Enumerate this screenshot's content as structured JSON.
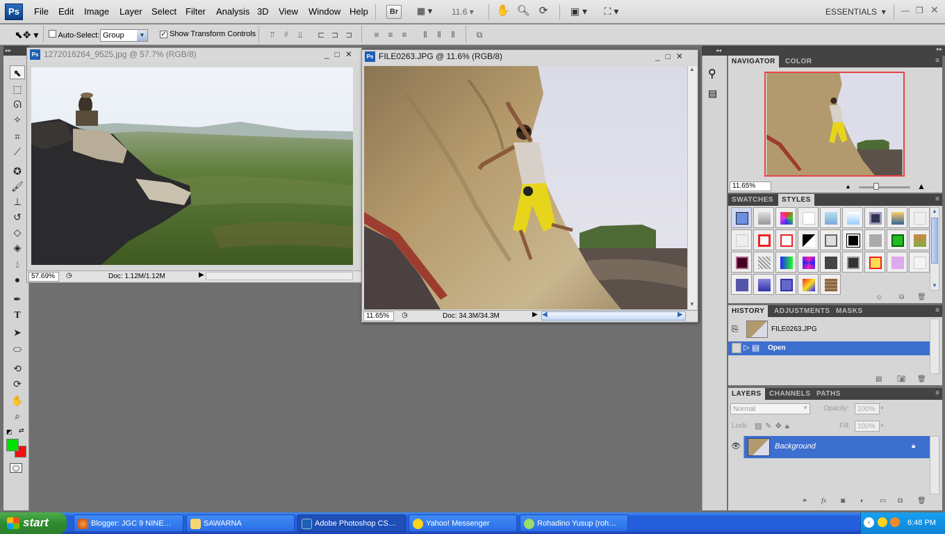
{
  "app": {
    "logo": "Ps"
  },
  "menu": [
    "File",
    "Edit",
    "Image",
    "Layer",
    "Select",
    "Filter",
    "Analysis",
    "3D",
    "View",
    "Window",
    "Help"
  ],
  "menubar": {
    "bridge_label": "Br",
    "zoom": "11.6",
    "workspace": "ESSENTIALS",
    "icons": [
      "bridge-icon",
      "screen-mode-icon",
      "hand-icon",
      "zoom-icon",
      "rotate-view-icon",
      "arrange-documents-icon",
      "screen-mode-menu-icon"
    ]
  },
  "options": {
    "auto_select_label": "Auto-Select:",
    "auto_select_checked": false,
    "group_value": "Group",
    "show_transform_label": "Show Transform Controls",
    "show_transform_checked": true
  },
  "documents": [
    {
      "title": "1272016264_9525.jpg @ 57.7% (RGB/8)",
      "zoom": "57.69%",
      "doc_size": "Doc: 1.12M/1.12M",
      "active": false
    },
    {
      "title": "FILE0263.JPG @ 11.6% (RGB/8)",
      "zoom": "11.65%",
      "doc_size": "Doc: 34.3M/34.3M",
      "active": true
    }
  ],
  "navigator": {
    "tabs": [
      "NAVIGATOR",
      "COLOR"
    ],
    "zoom": "11.65%"
  },
  "swatches": {
    "tabs": [
      "SWATCHES",
      "STYLES"
    ]
  },
  "history": {
    "tabs": [
      "HISTORY",
      "ADJUSTMENTS",
      "MASKS"
    ],
    "snapshot": "FILE0263.JPG",
    "states": [
      "Open"
    ]
  },
  "layers": {
    "tabs": [
      "LAYERS",
      "CHANNELS",
      "PATHS"
    ],
    "blend_mode": "Normal",
    "opacity_label": "Opacity:",
    "opacity": "100%",
    "lock_label": "Lock:",
    "fill_label": "Fill:",
    "fill": "100%",
    "items": [
      {
        "name": "Background",
        "locked": true
      }
    ]
  },
  "colors": {
    "foreground": "#00e000",
    "background": "#ee1111",
    "accent": "#3d6fcf"
  },
  "taskbar": {
    "start": "start",
    "tasks": [
      {
        "label": "Blogger: JGC 9 NINE…",
        "icon": "firefox-icon",
        "active": false
      },
      {
        "label": "SAWARNA",
        "icon": "folder-icon",
        "active": false
      },
      {
        "label": "Adobe Photoshop CS…",
        "icon": "photoshop-icon",
        "active": true
      },
      {
        "label": "Yahoo! Messenger",
        "icon": "yahoo-messenger-icon",
        "active": false
      },
      {
        "label": "Rohadino Yusup (roh…",
        "icon": "chat-icon",
        "active": false
      }
    ],
    "clock": "6:48 PM"
  }
}
